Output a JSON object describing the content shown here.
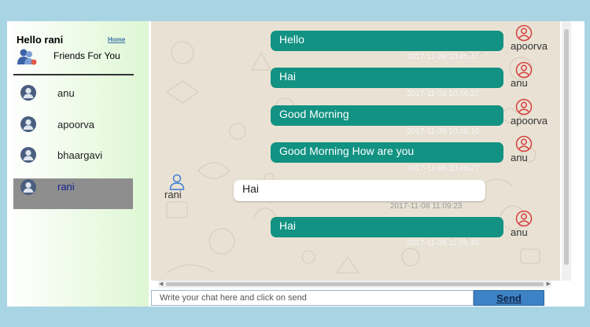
{
  "sidebar": {
    "greeting": "Hello rani",
    "home_link": "Home",
    "friends_label": "Friends For You",
    "contacts": [
      {
        "name": "anu",
        "active": false
      },
      {
        "name": "apoorva",
        "active": false
      },
      {
        "name": "bhaargavi",
        "active": false
      },
      {
        "name": "rani",
        "active": true
      }
    ]
  },
  "messages": [
    {
      "text": "Hello",
      "timestamp": "2017-11-08 10:45:47",
      "sender": "apoorva",
      "direction": "out"
    },
    {
      "text": "Hai",
      "timestamp": "2017-11-08 10:46:27",
      "sender": "anu",
      "direction": "out"
    },
    {
      "text": "Good Morning",
      "timestamp": "2017-11-08 10:48:16",
      "sender": "apoorva",
      "direction": "out"
    },
    {
      "text": "Good Morning How are you",
      "timestamp": "2017-11-08 10:48:27",
      "sender": "anu",
      "direction": "out"
    },
    {
      "text": "Hai",
      "timestamp": "2017-11-08 11:09:23",
      "sender": "rani",
      "direction": "in"
    },
    {
      "text": "Hai",
      "timestamp": "2017-11-08 11:09:40",
      "sender": "anu",
      "direction": "out"
    }
  ],
  "composer": {
    "placeholder": "Write your chat here and click on send",
    "send_label": "Send"
  },
  "colors": {
    "outgoing_bubble": "#129282",
    "incoming_bubble": "#ffffff",
    "page_background": "#a9d4e3",
    "active_contact": "#8e8e8e",
    "send_button": "#3c82c4"
  }
}
